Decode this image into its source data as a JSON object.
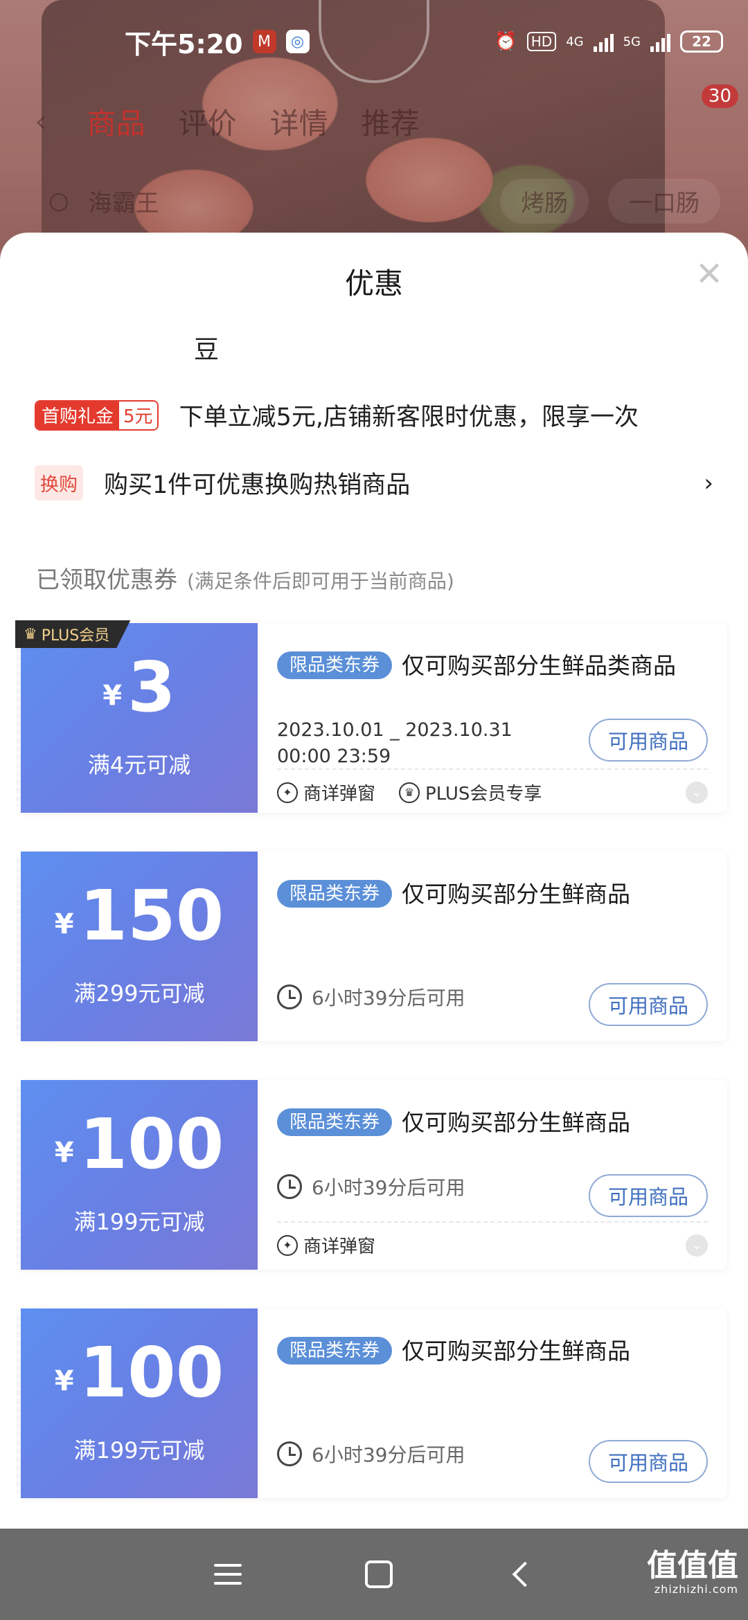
{
  "status_bar": {
    "time": "下午5:20",
    "network_hd": "HD",
    "network_4g": "4G",
    "network_5g": "5G",
    "battery": "22"
  },
  "product_page": {
    "tabs": [
      "商品",
      "评价",
      "详情",
      "推荐"
    ],
    "active_tab": "商品",
    "cart_count": "30",
    "search_text": "海霸王",
    "chips": [
      "烤肠",
      "一口肠"
    ]
  },
  "sheet": {
    "title": "优惠",
    "bean_text": "豆",
    "promos": [
      {
        "tag_main": "首购礼金",
        "tag_value": "5元",
        "text": "下单立减5元,店铺新客限时优惠，限享一次"
      },
      {
        "tag_main": "换购",
        "text": "购买1件可优惠换购热销商品",
        "chevron": "›"
      }
    ],
    "section_title": "已领取优惠券",
    "section_sub": "(满足条件后即可用于当前商品)",
    "coupons": [
      {
        "plus_badge": "PLUS会员",
        "yen": "¥",
        "amount": "3",
        "condition": "满4元可减",
        "category_tag": "限品类东券",
        "title": "仅可购买部分生鲜品类商品",
        "date_line1": "2023.10.01 _ 2023.10.31",
        "date_line2": "00:00 23:59",
        "button": "可用商品",
        "features": [
          "商详弹窗",
          "PLUS会员专享"
        ]
      },
      {
        "yen": "¥",
        "amount": "150",
        "condition": "满299元可减",
        "category_tag": "限品类东券",
        "title": "仅可购买部分生鲜商品",
        "countdown": "6小时39分后可用",
        "button": "可用商品"
      },
      {
        "yen": "¥",
        "amount": "100",
        "condition": "满199元可减",
        "category_tag": "限品类东券",
        "title": "仅可购买部分生鲜商品",
        "countdown": "6小时39分后可用",
        "button": "可用商品",
        "features": [
          "商详弹窗"
        ]
      },
      {
        "yen": "¥",
        "amount": "100",
        "condition": "满199元可减",
        "category_tag": "限品类东券",
        "title": "仅可购买部分生鲜商品",
        "countdown": "6小时39分后可用",
        "button": "可用商品"
      }
    ]
  },
  "watermark": {
    "main": "值值值",
    "sub": "zhizhizhi.com"
  },
  "colors": {
    "accent_red": "#e43a2e",
    "coupon_blue": "#5d8ff0",
    "tag_blue": "#5b8fd8",
    "button_text": "#3f6fbf"
  }
}
